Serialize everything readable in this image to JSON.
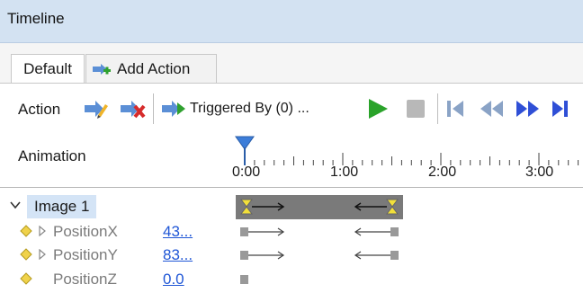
{
  "panel": {
    "title": "Timeline"
  },
  "tabs": [
    {
      "label": "Default",
      "active": true
    },
    {
      "label": "Add Action",
      "active": false
    }
  ],
  "action_row": {
    "label": "Action",
    "triggered_by": "Triggered By (0) ..."
  },
  "animation_row": {
    "label": "Animation",
    "ticks": [
      "0:00",
      "1:00",
      "2:00",
      "3:00"
    ]
  },
  "tree": {
    "root": {
      "label": "Image 1",
      "expanded": true
    },
    "children": [
      {
        "label": "PositionX",
        "value": "43...",
        "has_expander": true
      },
      {
        "label": "PositionY",
        "value": "83...",
        "has_expander": true
      },
      {
        "label": "PositionZ",
        "value": "0.0",
        "has_expander": false
      }
    ]
  },
  "colors": {
    "title_bg": "#d3e2f2",
    "selection_bg": "#d4e4f6",
    "link": "#1f56d6",
    "keyframe": "#f2e03a",
    "play": "#2aa32a"
  }
}
